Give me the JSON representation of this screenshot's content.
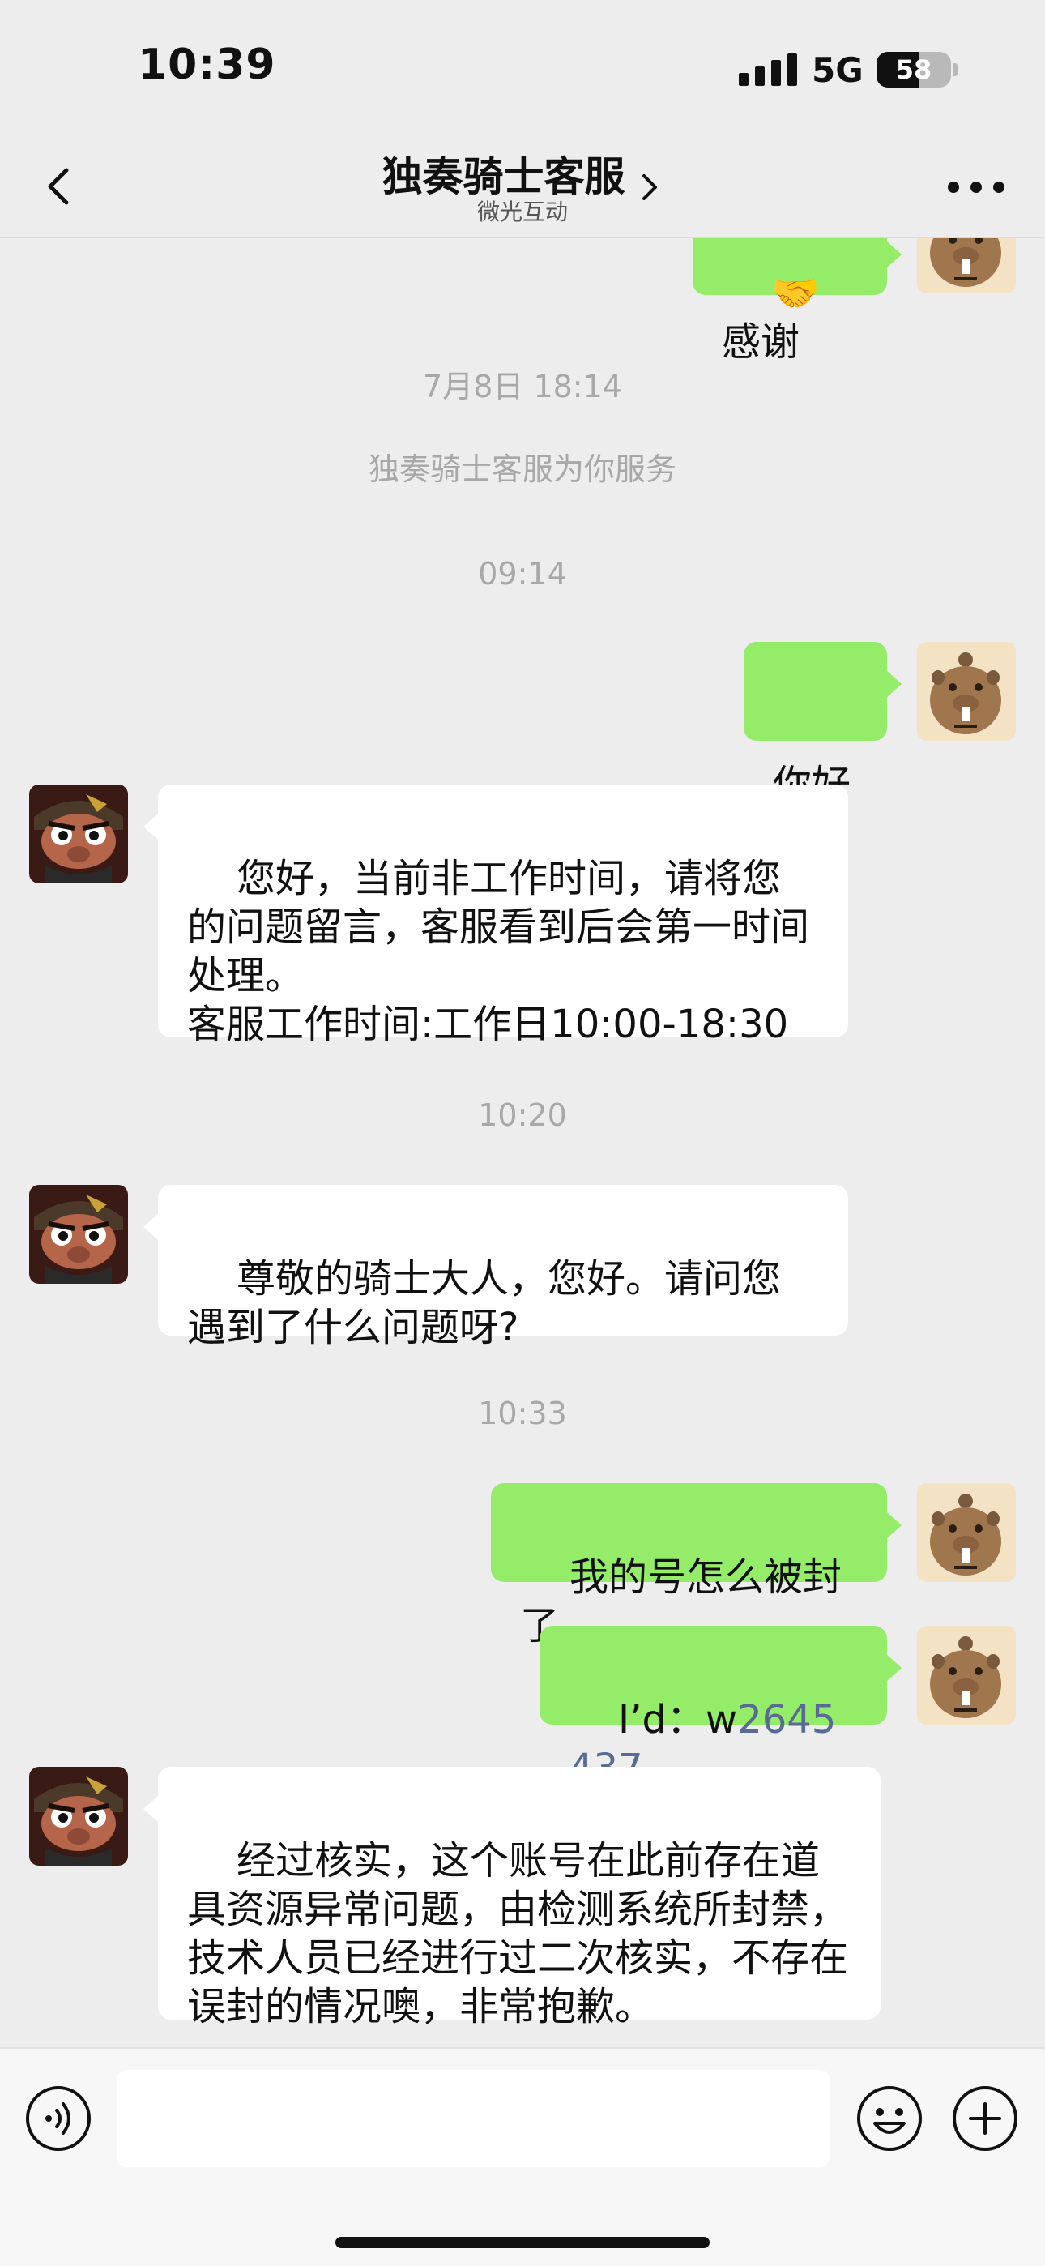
{
  "status": {
    "time": "10:39",
    "network": "5G",
    "battery": "58",
    "battery_level": 0.58
  },
  "nav": {
    "title": "独奏骑士客服",
    "subtitle": "微光互动"
  },
  "icons": {
    "back": "chevron-left-icon",
    "title_arrow": "chevron-right-icon",
    "more": "more-icon",
    "voice": "voice-icon",
    "emoji": "emoji-icon",
    "plus": "plus-icon"
  },
  "colors": {
    "background": "#EDEDED",
    "bubble_self": "#95EC69",
    "bubble_other": "#FFFFFF",
    "link": "#576B95",
    "timestamp": "#A8A8A8"
  },
  "messages": {
    "m0": {
      "text": "感谢",
      "emoji": "🤝"
    },
    "ts1": "7月8日 18:14",
    "sys1": "独奏骑士客服为你服务",
    "ts2": "09:14",
    "m1": {
      "text": "你好"
    },
    "m2": {
      "text": "您好，当前非工作时间，请将您的问题留言，客服看到后会第一时间处理。\n客服工作时间:工作日10:00-18:30"
    },
    "ts3": "10:20",
    "m3": {
      "text": "尊敬的骑士大人，您好。请问您遇到了什么问题呀?"
    },
    "ts4": "10:33",
    "m4": {
      "text": "我的号怎么被封了"
    },
    "m5": {
      "prefix": "I’d：w",
      "link": "2645437"
    },
    "m6": {
      "text": "经过核实，这个账号在此前存在道具资源异常问题，由检测系统所封禁，技术人员已经进行过二次核实，不存在误封的情况噢，非常抱歉。"
    }
  },
  "input": {
    "value": ""
  }
}
